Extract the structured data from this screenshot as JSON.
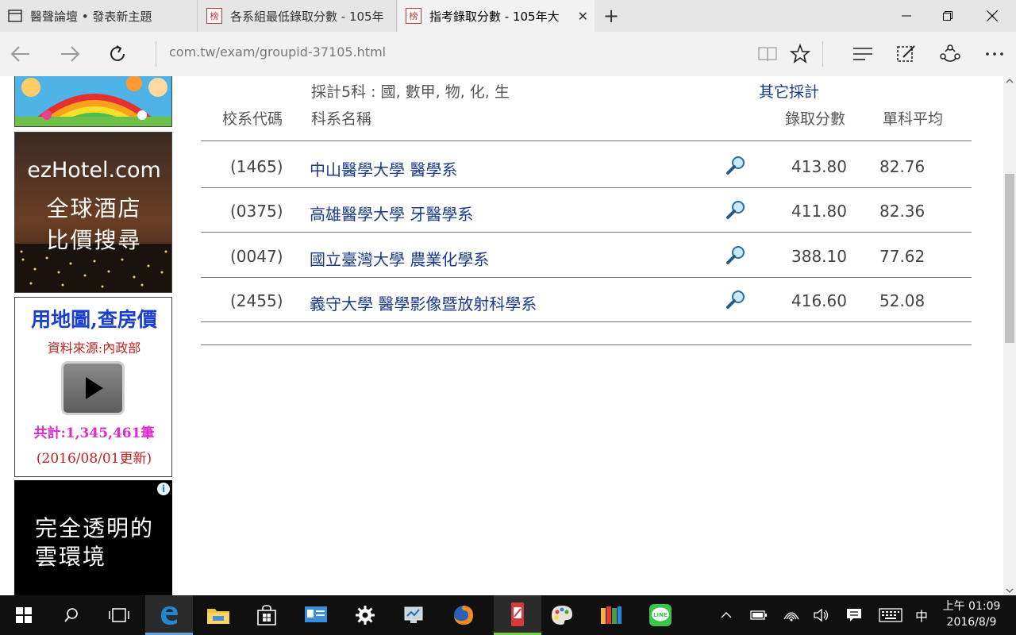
{
  "tabs": [
    {
      "title": "醫聲論壇 • 發表新主題"
    },
    {
      "title": "各系組最低錄取分數 - 105年"
    },
    {
      "title": "指考錄取分數 - 105年大"
    }
  ],
  "tab_icon_glyph": "榜",
  "new_tab": "+",
  "address": {
    "url": "com.tw/exam/groupid-37105.html"
  },
  "ads": {
    "ezhotel": {
      "brand": "ezHotel.com",
      "line1": "全球酒店",
      "line2": "比價搜尋"
    },
    "house": {
      "line1": "用地圖,查房價",
      "line2": "資料來源:內政部",
      "line3": "共計:1,345,461筆",
      "line4": "(2016/08/01更新)"
    },
    "cloud": {
      "line1": "完全透明的",
      "line2": "雲環境"
    }
  },
  "table": {
    "criteria": "採計5科 : 國, 數甲, 物, 化, 生",
    "other_link": "其它採計",
    "headers": {
      "code": "校系代碼",
      "name": "科系名稱",
      "score": "錄取分數",
      "avg": "單科平均"
    },
    "rows": [
      {
        "code": "(1465)",
        "name": "中山醫學大學 醫學系",
        "score": "413.80",
        "avg": "82.76"
      },
      {
        "code": "(0375)",
        "name": "高雄醫學大學 牙醫學系",
        "score": "411.80",
        "avg": "82.36"
      },
      {
        "code": "(0047)",
        "name": "國立臺灣大學 農業化學系",
        "score": "388.10",
        "avg": "77.62"
      },
      {
        "code": "(2455)",
        "name": "義守大學 醫學影像暨放射科學系",
        "score": "416.60",
        "avg": "52.08"
      }
    ]
  },
  "taskbar": {
    "ime": "中",
    "time": "上午 01:09",
    "date": "2016/8/9"
  },
  "colors": {
    "link": "#1a3a8a",
    "accent": "#6aa0d8"
  }
}
